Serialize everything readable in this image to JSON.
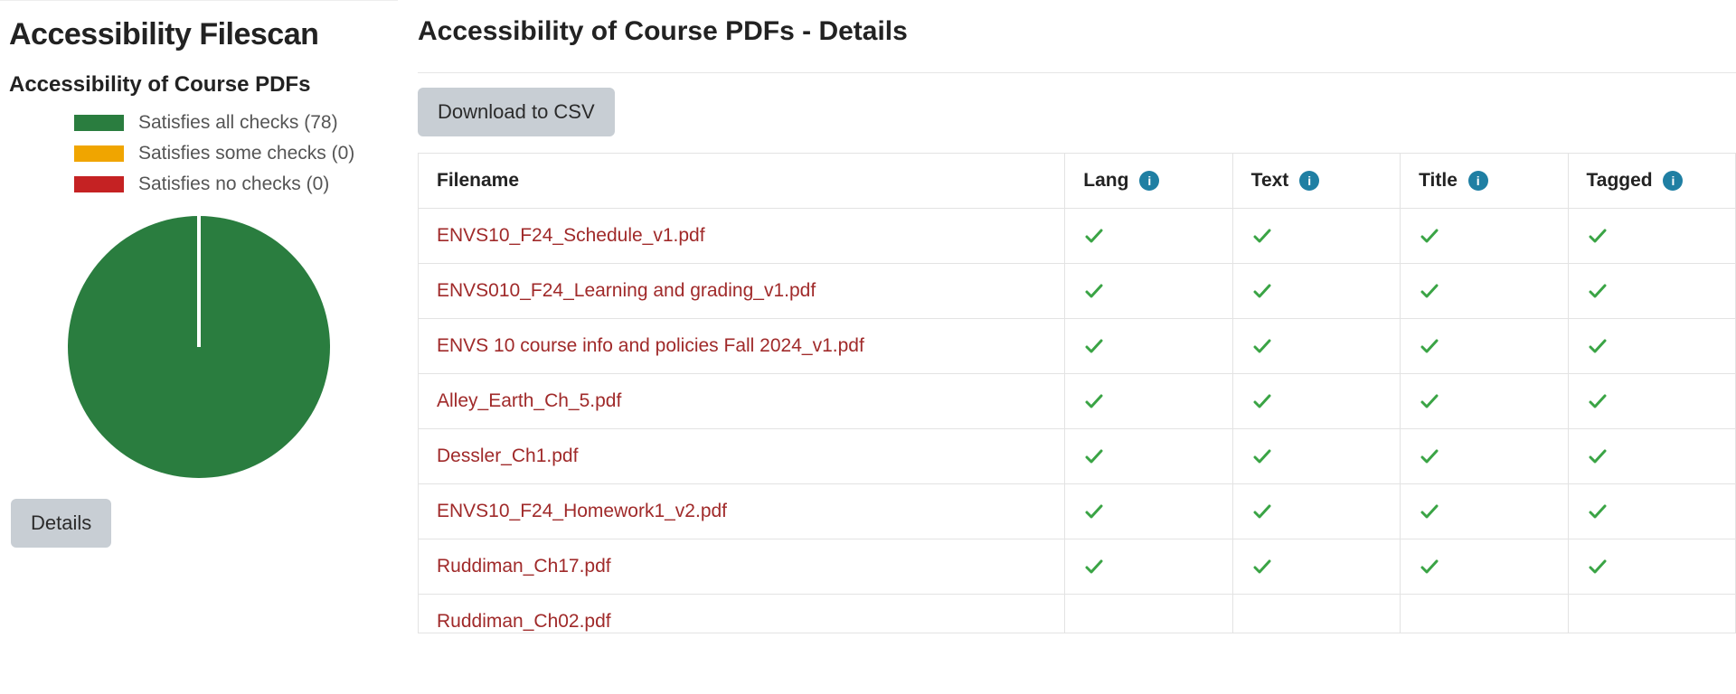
{
  "sidebar": {
    "title": "Accessibility Filescan",
    "subtitle": "Accessibility of Course PDFs",
    "legend": [
      {
        "label": "Satisfies all checks (78)",
        "color_class": "green"
      },
      {
        "label": "Satisfies some checks (0)",
        "color_class": "orange"
      },
      {
        "label": "Satisfies no checks (0)",
        "color_class": "red"
      }
    ],
    "details_button": "Details"
  },
  "main": {
    "title": "Accessibility of Course PDFs - Details",
    "csv_button": "Download to CSV",
    "columns": {
      "filename": "Filename",
      "lang": "Lang",
      "text": "Text",
      "title": "Title",
      "tagged": "Tagged"
    },
    "files": [
      {
        "name": "ENVS10_F24_Schedule_v1.pdf",
        "lang": true,
        "text": true,
        "title": true,
        "tagged": true
      },
      {
        "name": "ENVS010_F24_Learning and grading_v1.pdf",
        "lang": true,
        "text": true,
        "title": true,
        "tagged": true
      },
      {
        "name": "ENVS 10 course info and policies Fall 2024_v1.pdf",
        "lang": true,
        "text": true,
        "title": true,
        "tagged": true
      },
      {
        "name": "Alley_Earth_Ch_5.pdf",
        "lang": true,
        "text": true,
        "title": true,
        "tagged": true
      },
      {
        "name": "Dessler_Ch1.pdf",
        "lang": true,
        "text": true,
        "title": true,
        "tagged": true
      },
      {
        "name": "ENVS10_F24_Homework1_v2.pdf",
        "lang": true,
        "text": true,
        "title": true,
        "tagged": true
      },
      {
        "name": "Ruddiman_Ch17.pdf",
        "lang": true,
        "text": true,
        "title": true,
        "tagged": true
      }
    ],
    "partial_row": "Ruddiman_Ch02.pdf"
  },
  "chart_data": {
    "type": "pie",
    "title": "Accessibility of Course PDFs",
    "series": [
      {
        "name": "Satisfies all checks",
        "value": 78,
        "color": "#2a7d3f"
      },
      {
        "name": "Satisfies some checks",
        "value": 0,
        "color": "#f0a500"
      },
      {
        "name": "Satisfies no checks",
        "value": 0,
        "color": "#c52223"
      }
    ]
  }
}
